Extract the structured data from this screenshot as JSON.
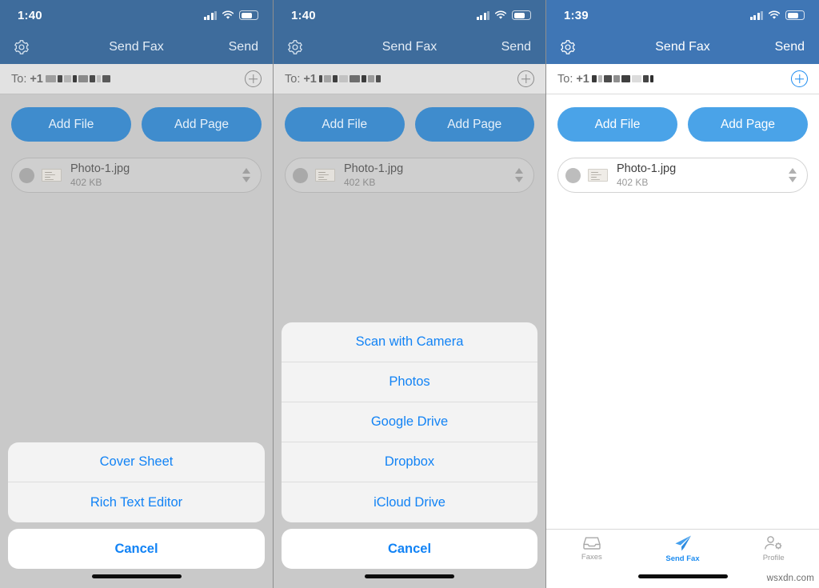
{
  "colors": {
    "nav_blue_dim": "#3e6c9c",
    "nav_blue": "#3f76b5",
    "button_blue_dim": "#3f8ccd",
    "button_blue": "#4aa3e8",
    "accent_blue": "#1283f5",
    "tab_active": "#1d8cf0",
    "dim_background": "#c9c9c9",
    "white_background": "#ffffff"
  },
  "watermark": "wsxdn.com",
  "panels": [
    {
      "id": "panel-cover-sheet-sheet",
      "status": {
        "time": "1:40",
        "signal_icon": "cellular-bars-icon",
        "wifi_icon": "wifi-icon",
        "battery_icon": "battery-icon"
      },
      "nav": {
        "settings_icon": "gear-icon",
        "title": "Send Fax",
        "send_label": "Send"
      },
      "to": {
        "label": "To:",
        "country_code": "+1",
        "number_redacted": true,
        "add_icon": "plus-circle-icon"
      },
      "actions": {
        "add_file": "Add File",
        "add_page": "Add Page"
      },
      "file": {
        "remove_icon": "close-circle-icon",
        "thumbnail_icon": "document-thumbnail",
        "name": "Photo-1.jpg",
        "size": "402 KB",
        "reorder_icon": "sort-updown-icon"
      },
      "sheet": {
        "items": [
          "Cover Sheet",
          "Rich Text Editor"
        ],
        "cancel": "Cancel"
      },
      "has_tabbar": false
    },
    {
      "id": "panel-add-file-sheet",
      "status": {
        "time": "1:40",
        "signal_icon": "cellular-bars-icon",
        "wifi_icon": "wifi-icon",
        "battery_icon": "battery-icon"
      },
      "nav": {
        "settings_icon": "gear-icon",
        "title": "Send Fax",
        "send_label": "Send"
      },
      "to": {
        "label": "To:",
        "country_code": "+1",
        "number_redacted": true,
        "add_icon": "plus-circle-icon"
      },
      "actions": {
        "add_file": "Add File",
        "add_page": "Add Page"
      },
      "file": {
        "remove_icon": "close-circle-icon",
        "thumbnail_icon": "document-thumbnail",
        "name": "Photo-1.jpg",
        "size": "402 KB",
        "reorder_icon": "sort-updown-icon"
      },
      "sheet": {
        "items": [
          "Scan with Camera",
          "Photos",
          "Google Drive",
          "Dropbox",
          "iCloud Drive"
        ],
        "cancel": "Cancel"
      },
      "has_tabbar": false
    },
    {
      "id": "panel-send-fax",
      "status": {
        "time": "1:39",
        "signal_icon": "cellular-bars-icon",
        "wifi_icon": "wifi-icon",
        "battery_icon": "battery-icon"
      },
      "nav": {
        "settings_icon": "gear-icon",
        "title": "Send Fax",
        "send_label": "Send"
      },
      "to": {
        "label": "To:",
        "country_code": "+1",
        "number_redacted": true,
        "add_icon": "plus-circle-icon"
      },
      "actions": {
        "add_file": "Add File",
        "add_page": "Add Page"
      },
      "file": {
        "remove_icon": "close-circle-icon",
        "thumbnail_icon": "document-thumbnail",
        "name": "Photo-1.jpg",
        "size": "402 KB",
        "reorder_icon": "sort-updown-icon"
      },
      "sheet": null,
      "has_tabbar": true,
      "tabs": [
        {
          "label": "Faxes",
          "icon": "inbox-tray-icon",
          "active": false
        },
        {
          "label": "Send Fax",
          "icon": "paper-plane-icon",
          "active": true
        },
        {
          "label": "Profile",
          "icon": "person-gear-icon",
          "active": false
        }
      ]
    }
  ]
}
